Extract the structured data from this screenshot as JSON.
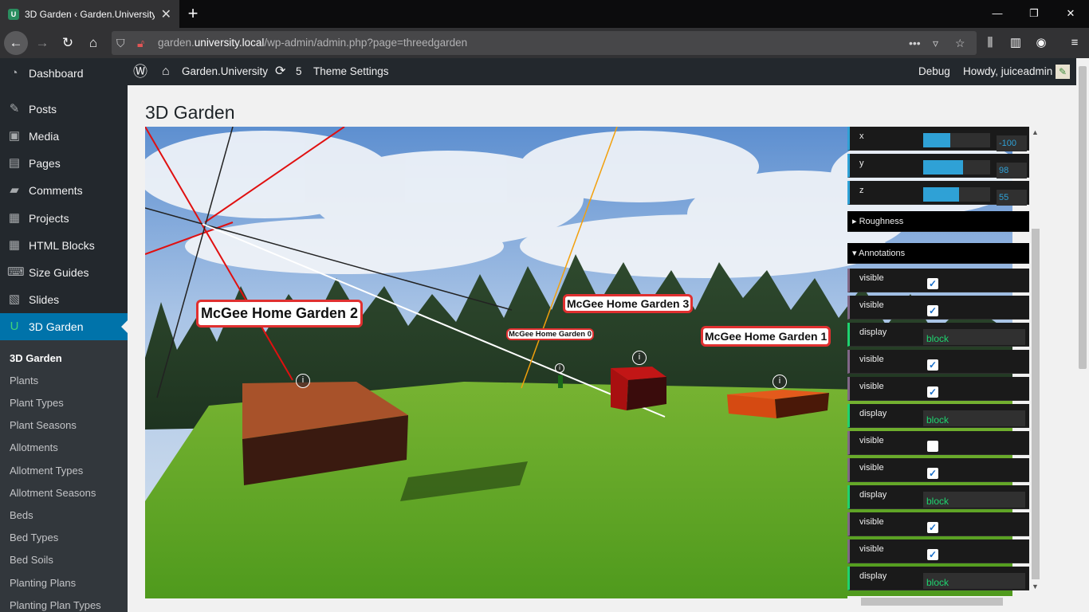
{
  "browser": {
    "tab_title": "3D Garden ‹ Garden.University —",
    "url_prefix": "garden.",
    "url_host": "university.local",
    "url_path": "/wp-admin/admin.php?page=threedgarden"
  },
  "adminbar": {
    "site_name": "Garden.University",
    "updates_count": "5",
    "theme_settings": "Theme Settings",
    "debug": "Debug",
    "howdy": "Howdy, juiceadmin"
  },
  "sidebar": {
    "items": [
      {
        "label": "Dashboard",
        "icon": "dashboard-icon"
      },
      {
        "label": "Posts",
        "icon": "pin-icon"
      },
      {
        "label": "Media",
        "icon": "media-icon"
      },
      {
        "label": "Pages",
        "icon": "page-icon"
      },
      {
        "label": "Comments",
        "icon": "comment-icon"
      },
      {
        "label": "Projects",
        "icon": "portfolio-icon"
      },
      {
        "label": "HTML Blocks",
        "icon": "grid-icon"
      },
      {
        "label": "Size Guides",
        "icon": "keyboard-icon"
      },
      {
        "label": "Slides",
        "icon": "slides-icon"
      },
      {
        "label": "3D Garden",
        "icon": "garden-icon"
      }
    ],
    "submenu": [
      "3D Garden",
      "Plants",
      "Plant Types",
      "Plant Seasons",
      "Allotments",
      "Allotment Types",
      "Allotment Seasons",
      "Beds",
      "Bed Types",
      "Bed Soils",
      "Planting Plans",
      "Planting Plan Types"
    ]
  },
  "page": {
    "title": "3D Garden"
  },
  "scene": {
    "labels": [
      "McGee Home Garden 2",
      "McGee Home Garden 3",
      "McGee Home Garden 0",
      "McGee Home Garden 1"
    ],
    "info_glyph": "i"
  },
  "gui": {
    "position": [
      {
        "label": "x",
        "value": "-100",
        "fill": 0.4
      },
      {
        "label": "y",
        "value": "98",
        "fill": 0.6
      },
      {
        "label": "z",
        "value": "55",
        "fill": 0.54
      }
    ],
    "roughness_folder": "Roughness",
    "annotations_folder": "Annotations",
    "annotations": [
      {
        "type": "bool",
        "label": "visible",
        "checked": true
      },
      {
        "type": "bool",
        "label": "visible",
        "checked": true
      },
      {
        "type": "str",
        "label": "display",
        "value": "block"
      },
      {
        "type": "bool",
        "label": "visible",
        "checked": true
      },
      {
        "type": "bool",
        "label": "visible",
        "checked": true
      },
      {
        "type": "str",
        "label": "display",
        "value": "block"
      },
      {
        "type": "bool",
        "label": "visible",
        "checked": false
      },
      {
        "type": "bool",
        "label": "visible",
        "checked": true
      },
      {
        "type": "str",
        "label": "display",
        "value": "block"
      },
      {
        "type": "bool",
        "label": "visible",
        "checked": true
      },
      {
        "type": "bool",
        "label": "visible",
        "checked": true
      },
      {
        "type": "str",
        "label": "display",
        "value": "block"
      }
    ]
  }
}
